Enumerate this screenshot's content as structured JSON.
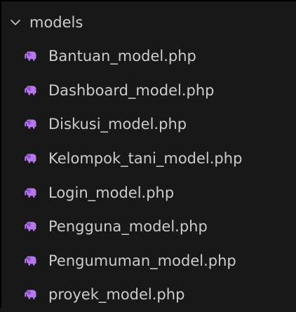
{
  "explorer": {
    "folder": {
      "name": "models",
      "expanded": true,
      "icon": "chevron-down-icon"
    },
    "file_icon": "php-elephant-icon",
    "colors": {
      "background": "#181818",
      "text": "#cccccc",
      "php_icon": "#b478ea"
    },
    "files": [
      {
        "name": "Bantuan_model.php"
      },
      {
        "name": "Dashboard_model.php"
      },
      {
        "name": "Diskusi_model.php"
      },
      {
        "name": "Kelompok_tani_model.php"
      },
      {
        "name": "Login_model.php"
      },
      {
        "name": "Pengguna_model.php"
      },
      {
        "name": "Pengumuman_model.php"
      },
      {
        "name": "proyek_model.php"
      }
    ]
  }
}
